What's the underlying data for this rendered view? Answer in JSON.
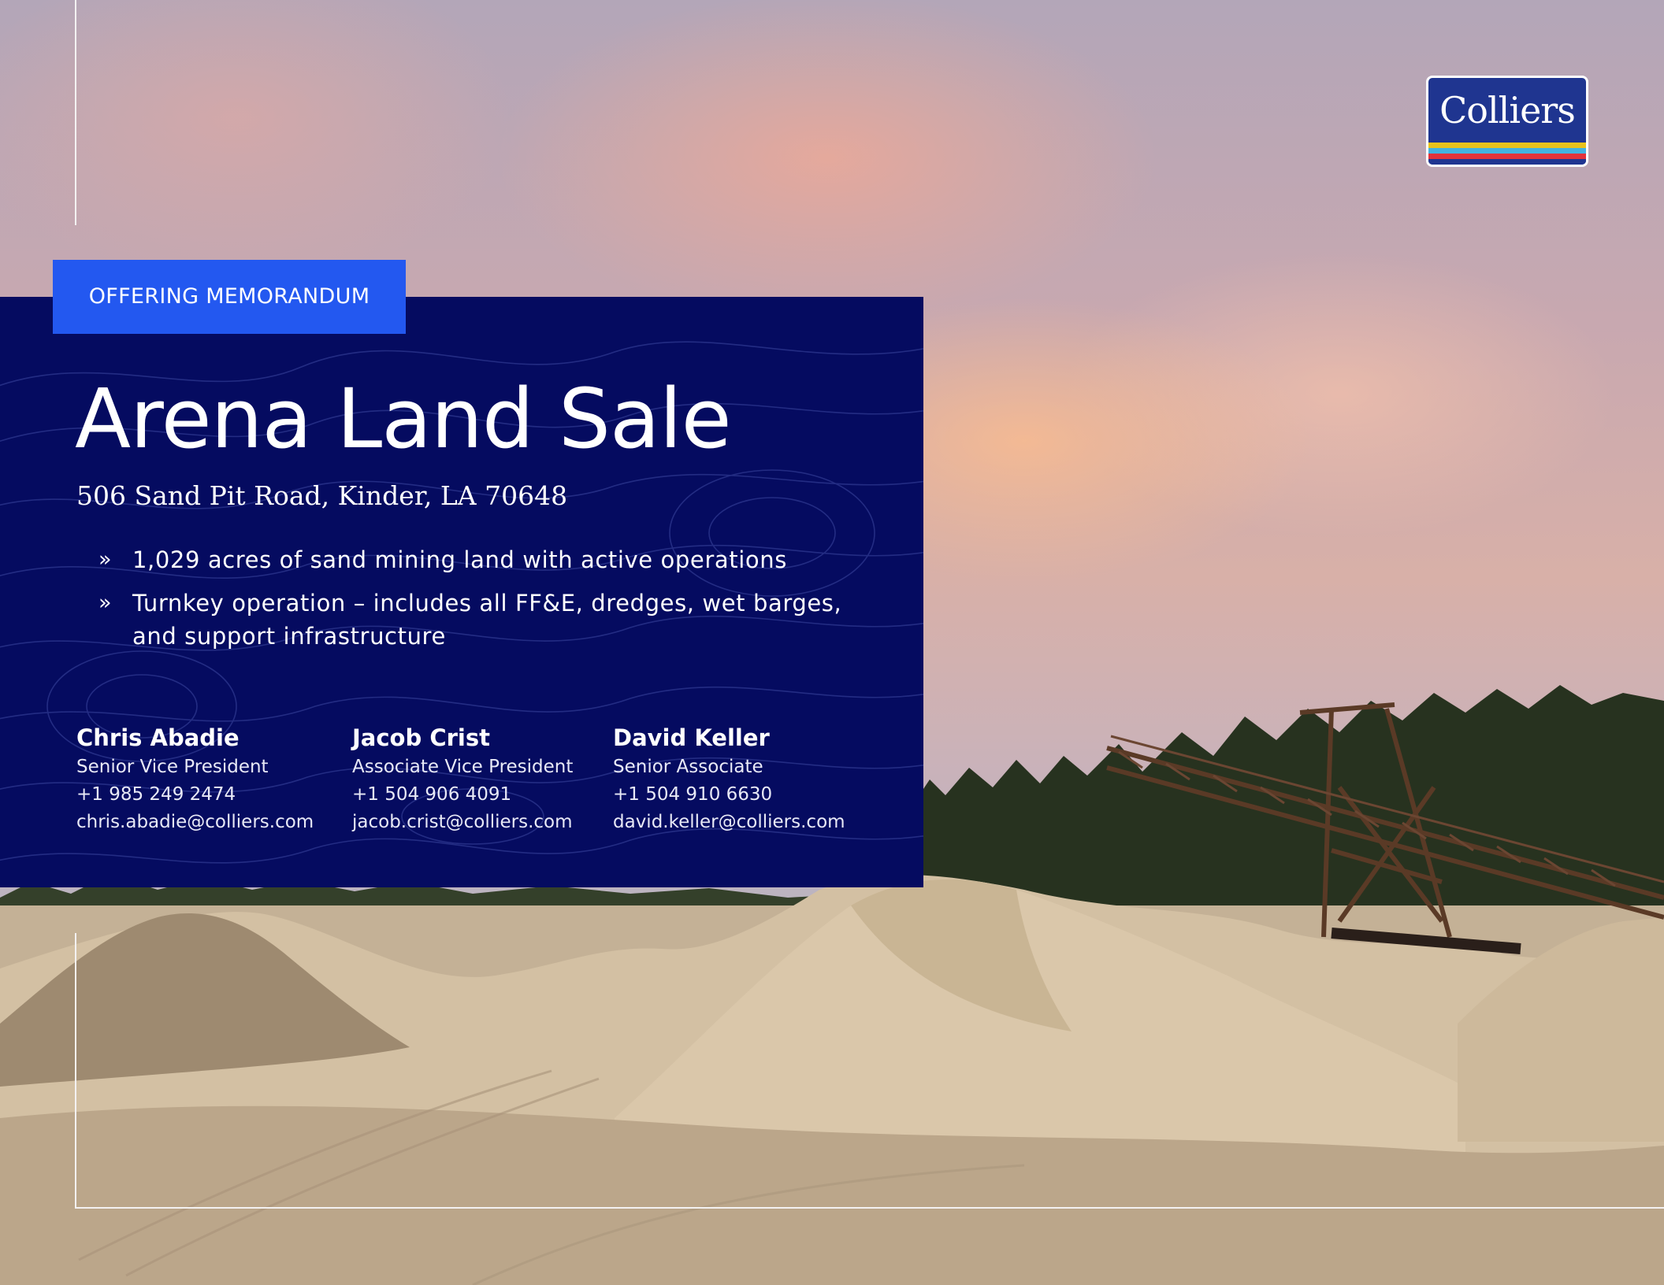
{
  "document": {
    "tag": "OFFERING MEMORANDUM",
    "title": "Arena Land Sale",
    "address": "506 Sand Pit Road, Kinder, LA 70648",
    "bullet_marker": "»",
    "bullets": [
      "1,029 acres of sand mining land with active operations",
      "Turnkey operation – includes all FF&E, dredges, wet barges, and support infrastructure"
    ],
    "contacts": [
      {
        "name": "Chris Abadie",
        "role": "Senior Vice President",
        "phone": "+1 985 249 2474",
        "email": "chris.abadie@colliers.com"
      },
      {
        "name": "Jacob Crist",
        "role": "Associate Vice President",
        "phone": "+1 504 906 4091",
        "email": "jacob.crist@colliers.com"
      },
      {
        "name": "David Keller",
        "role": "Senior Associate",
        "phone": "+1 504 910 6630",
        "email": "david.keller@colliers.com"
      }
    ]
  },
  "logo": {
    "wordmark": "Colliers",
    "background": "#1f3590",
    "stripe_colors": [
      "#e8c21c",
      "#43b2e0",
      "#e2333b",
      "#1f3590"
    ]
  },
  "colors": {
    "panel": "#050b60",
    "tag": "#2358f0",
    "frame_lines": "#f3f1f1"
  }
}
